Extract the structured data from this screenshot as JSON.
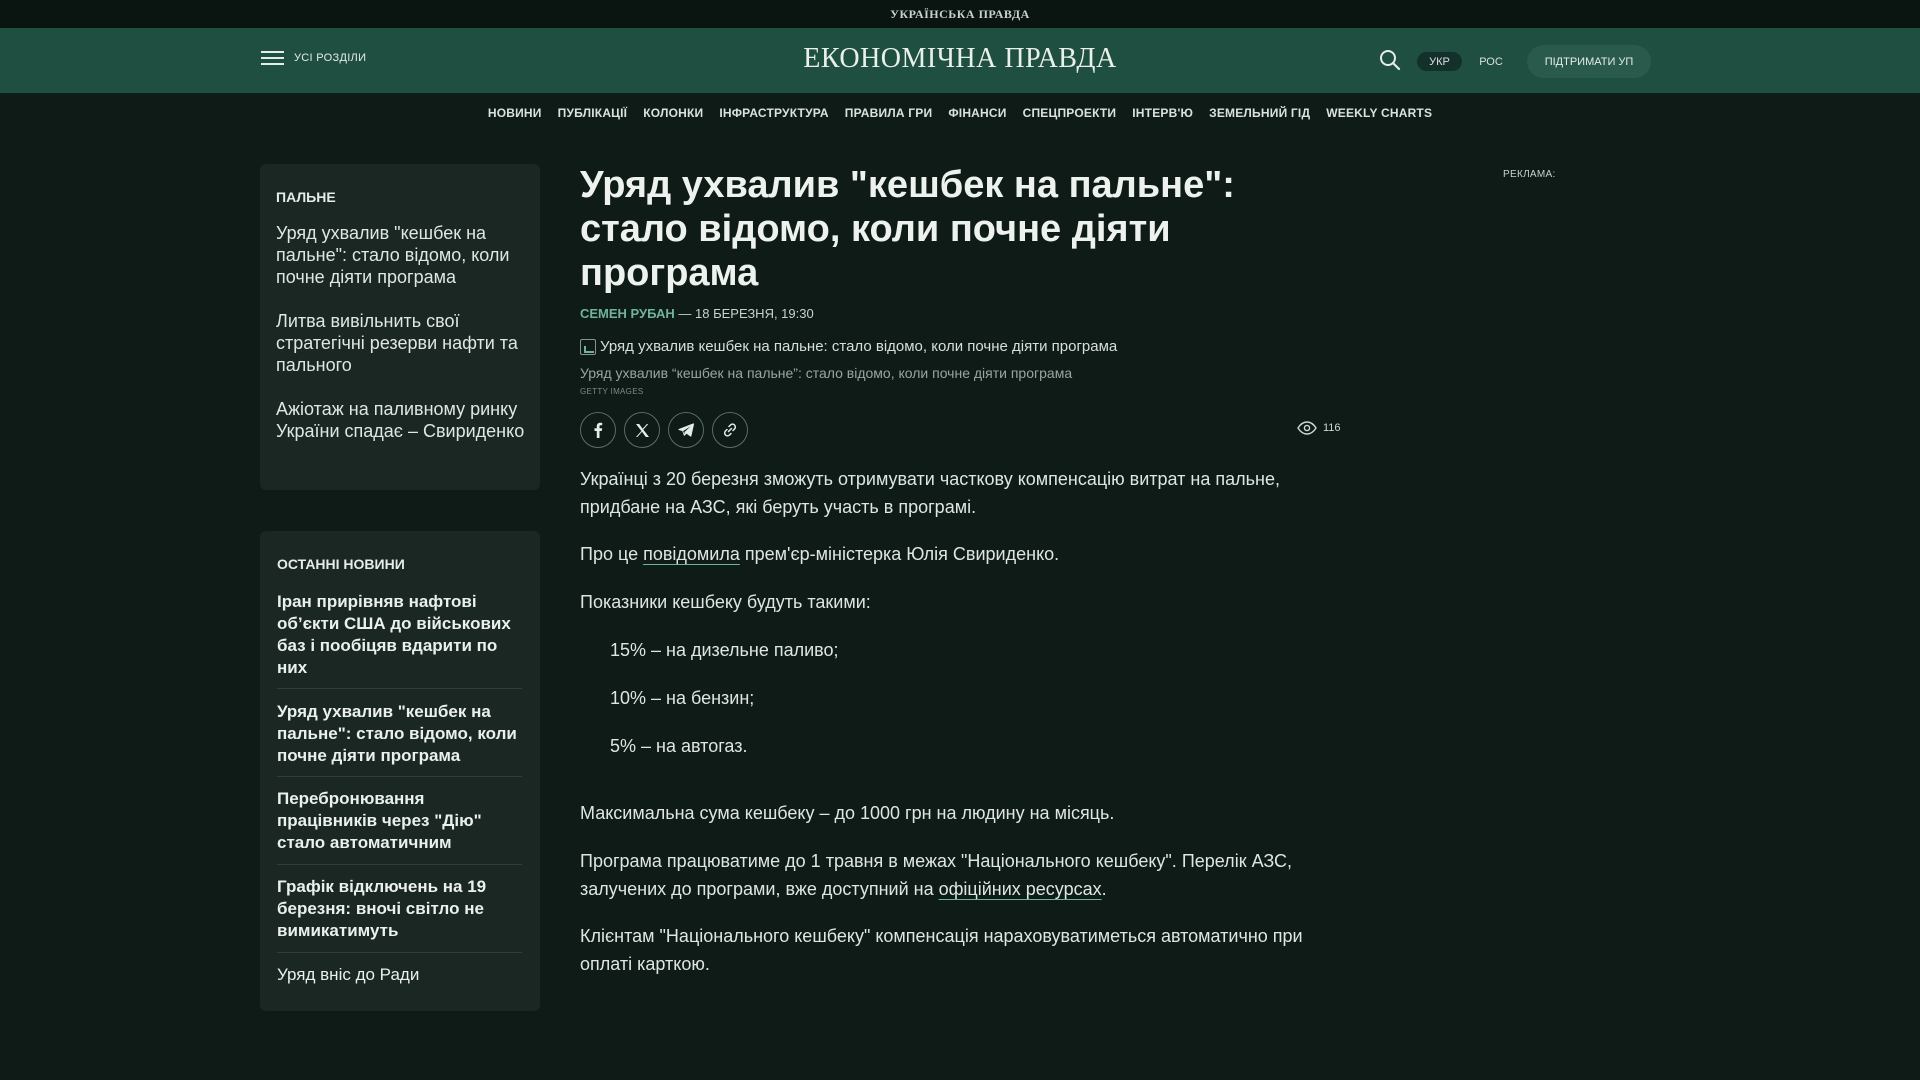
{
  "topbar": {
    "brand": "УКРАЇНСЬКА ПРАВДА"
  },
  "header": {
    "menu_label": "УСІ РОЗДІЛИ",
    "logo": "ЕКОНОМІЧНА ПРАВДА",
    "lang_active": "УКР",
    "lang_other": "РОС",
    "support_label": "ПІДТРИМАТИ УП",
    "icons": [
      "hamburger-menu-icon",
      "search-icon"
    ]
  },
  "nav": [
    "НОВИНИ",
    "ПУБЛІКАЦІЇ",
    "КОЛОНКИ",
    "ІНФРАСТРУКТУРА",
    "ПРАВИЛА ГРИ",
    "ФІНАНСИ",
    "СПЕЦПРОЕКТИ",
    "ІНТЕРВ'Ю",
    "ЗЕМЕЛЬНИЙ ГІД",
    "WEEKLY CHARTS"
  ],
  "tag_box": {
    "title": "ПАЛЬНЕ",
    "items": [
      "Уряд ухвалив \"кешбек на пальне\": стало відомо, коли почне діяти програма",
      "Литва вивільнить свої стратегічні резерви нафти та пального",
      "Ажіотаж на паливному ринку України спадає – Свириденко"
    ]
  },
  "latest": {
    "title": "ОСТАННІ НОВИНИ",
    "items": [
      "Іран прирівняв нафтові об’єкти США до військових баз і пообіцяв вдарити по них",
      "Уряд ухвалив \"кешбек на пальне\": стало відомо, коли почне діяти програма",
      "Переброн­ювання працівників через \"Дію\" стало автоматичним",
      "Графік відключень на 19 березня: вночі світло не вимикатимуть",
      "Уряд вніс до Ради"
    ]
  },
  "article": {
    "title": "Уряд ухвалив \"кешбек на пальне\": стало відомо, коли почне діяти програма",
    "author": "СЕМЕН РУБАН",
    "date": " — 18 БЕРЕЗНЯ, 19:30",
    "image_alt": "Уряд ухвалив кешбек на пальне: стало відомо, коли почне діяти програма",
    "caption": "Уряд ухвалив “кешбек на пальне”: стало відомо, коли почне діяти програма",
    "credit": "GETTY IMAGES",
    "views": "116",
    "share_icons": [
      "facebook-icon",
      "x-icon",
      "telegram-icon",
      "link-icon"
    ],
    "p1": "Українці з 20 березня зможуть отримувати часткову компенсацію витрат на пальне, придбане на АЗС, які беруть участь в програмі.",
    "p2_pre": "Про це ",
    "p2_link": "повідомила",
    "p2_post": " прем'єр-міністерка Юлія Свириденко.",
    "p3": "Показники кешбеку будуть такими:",
    "list": [
      "15% – на дизельне паливо;",
      "10% – на бензин;",
      "5% – на автогаз."
    ],
    "p4": "Максимальна сума кешбеку – до 1000 грн на людину на місяць.",
    "p5_pre": "Програма працюватиме до 1 травня в межах \"Національного кешбеку\". Перелік АЗС, залучених до програми, вже доступний на ",
    "p5_link": "офіційних ресурсах",
    "p5_post": ".",
    "p6": "Клієнтам \"Національного кешбеку\" компенсація нараховуватиметься автоматично при оплаті карткою."
  },
  "ad": {
    "label": "РЕКЛАМА:"
  },
  "colors": {
    "background": "#0f1b16",
    "header": "#1f4f41",
    "accent": "#6fb39a",
    "card": "#1a2722"
  }
}
